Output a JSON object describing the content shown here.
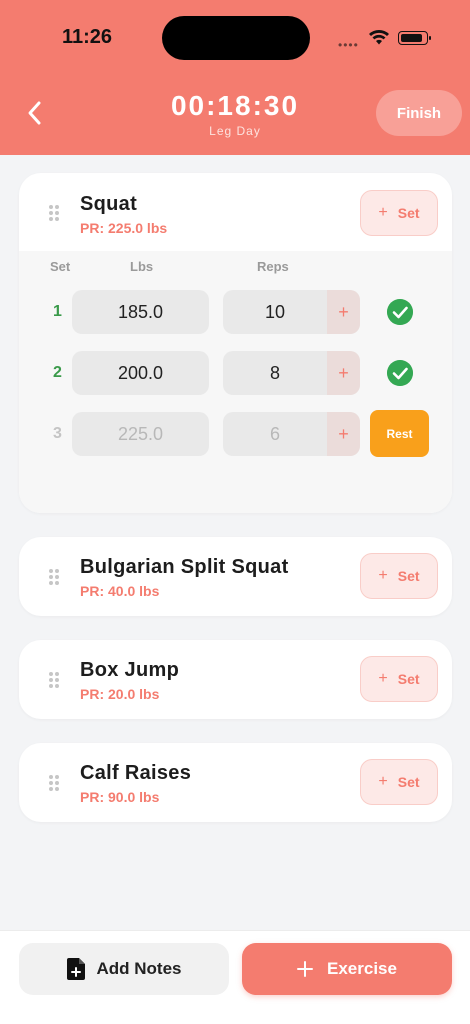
{
  "status_bar": {
    "time": "11:26",
    "dots": "••••"
  },
  "header": {
    "timer": "00:18:30",
    "workout_name": "Leg Day",
    "finish_label": "Finish"
  },
  "sets_header": {
    "set": "Set",
    "lbs": "Lbs",
    "reps": "Reps"
  },
  "exercises": [
    {
      "name": "Squat",
      "pr": "PR: 225.0 lbs",
      "add_set_label": "Set",
      "sets": [
        {
          "num": "1",
          "lbs": "185.0",
          "reps": "10",
          "status": "done"
        },
        {
          "num": "2",
          "lbs": "200.0",
          "reps": "8",
          "status": "done"
        },
        {
          "num": "3",
          "lbs": "225.0",
          "reps": "6",
          "status": "pending",
          "action_label": "Rest"
        }
      ]
    },
    {
      "name": "Bulgarian Split Squat",
      "pr": "PR: 40.0 lbs",
      "add_set_label": "Set"
    },
    {
      "name": "Box Jump",
      "pr": "PR: 20.0 lbs",
      "add_set_label": "Set"
    },
    {
      "name": "Calf Raises",
      "pr": "PR: 90.0 lbs",
      "add_set_label": "Set"
    }
  ],
  "bottom_bar": {
    "notes_label": "Add Notes",
    "exercise_label": "Exercise"
  },
  "colors": {
    "accent": "#f47c6f",
    "done": "#34a853",
    "rest": "#f9a01b"
  }
}
